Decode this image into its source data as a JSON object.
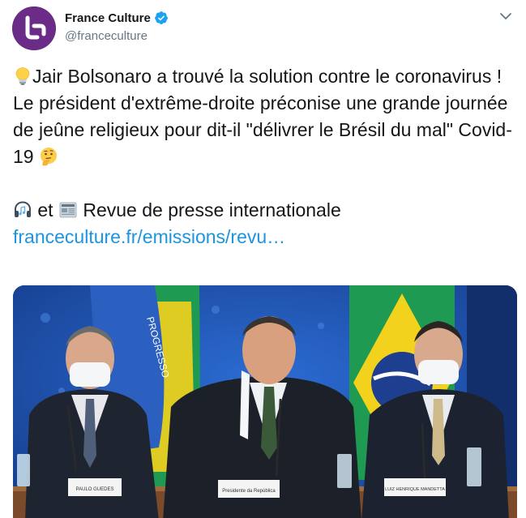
{
  "author": {
    "name": "France Culture",
    "handle": "@franceculture",
    "verified": true,
    "avatar_color": "#6a2c87"
  },
  "icons": {
    "verified": "verified-badge-icon",
    "more": "chevron-down-icon",
    "lightbulb": "lightbulb-emoji",
    "thinking": "thinking-face-emoji",
    "headphones": "headphones-emoji",
    "newspaper": "newspaper-emoji"
  },
  "tweet": {
    "line1": "Jair Bolsonaro a trouvé la solution contre le coronavirus !",
    "line2": "Le président d'extrême-droite préconise une grande journée de jeûne religieux pour dit-il \"délivrer le Brésil du mal\" Covid-19",
    "line3_and": "et",
    "line3_text": "Revue de presse internationale",
    "link": "franceculture.fr/emissions/revu…"
  },
  "media": {
    "placards": [
      "PAULO GUEDES",
      "Presidente da República",
      "LUIZ HENRIQUE MANDETTA"
    ],
    "banner_text": "PROGRESSO"
  },
  "colors": {
    "link": "#1b95e0",
    "verified": "#1da1f2",
    "handle": "#657786",
    "text": "#14171a"
  }
}
